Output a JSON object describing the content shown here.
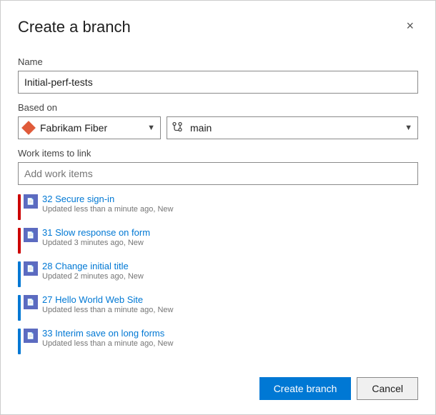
{
  "dialog": {
    "title": "Create a branch",
    "close_label": "×"
  },
  "name_field": {
    "label": "Name",
    "value": "Initial-perf-tests",
    "placeholder": ""
  },
  "based_on": {
    "label": "Based on",
    "repo": {
      "value": "Fabrikam Fiber",
      "options": [
        "Fabrikam Fiber"
      ]
    },
    "branch": {
      "value": "main",
      "options": [
        "main"
      ]
    }
  },
  "work_items": {
    "label": "Work items to link",
    "placeholder": "Add work items",
    "items": [
      {
        "id": 32,
        "title": "Secure sign-in",
        "meta": "Updated less than a minute ago, New",
        "color": "#cc0000",
        "icon_bg": "#5c6bc0"
      },
      {
        "id": 31,
        "title": "Slow response on form",
        "meta": "Updated 3 minutes ago, New",
        "color": "#cc0000",
        "icon_bg": "#5c6bc0"
      },
      {
        "id": 28,
        "title": "Change initial title",
        "meta": "Updated 2 minutes ago, New",
        "color": "#0078d4",
        "icon_bg": "#5c6bc0"
      },
      {
        "id": 27,
        "title": "Hello World Web Site",
        "meta": "Updated less than a minute ago, New",
        "color": "#0078d4",
        "icon_bg": "#5c6bc0"
      },
      {
        "id": 33,
        "title": "Interim save on long forms",
        "meta": "Updated less than a minute ago, New",
        "color": "#0078d4",
        "icon_bg": "#5c6bc0"
      }
    ]
  },
  "footer": {
    "create_label": "Create branch",
    "cancel_label": "Cancel"
  }
}
